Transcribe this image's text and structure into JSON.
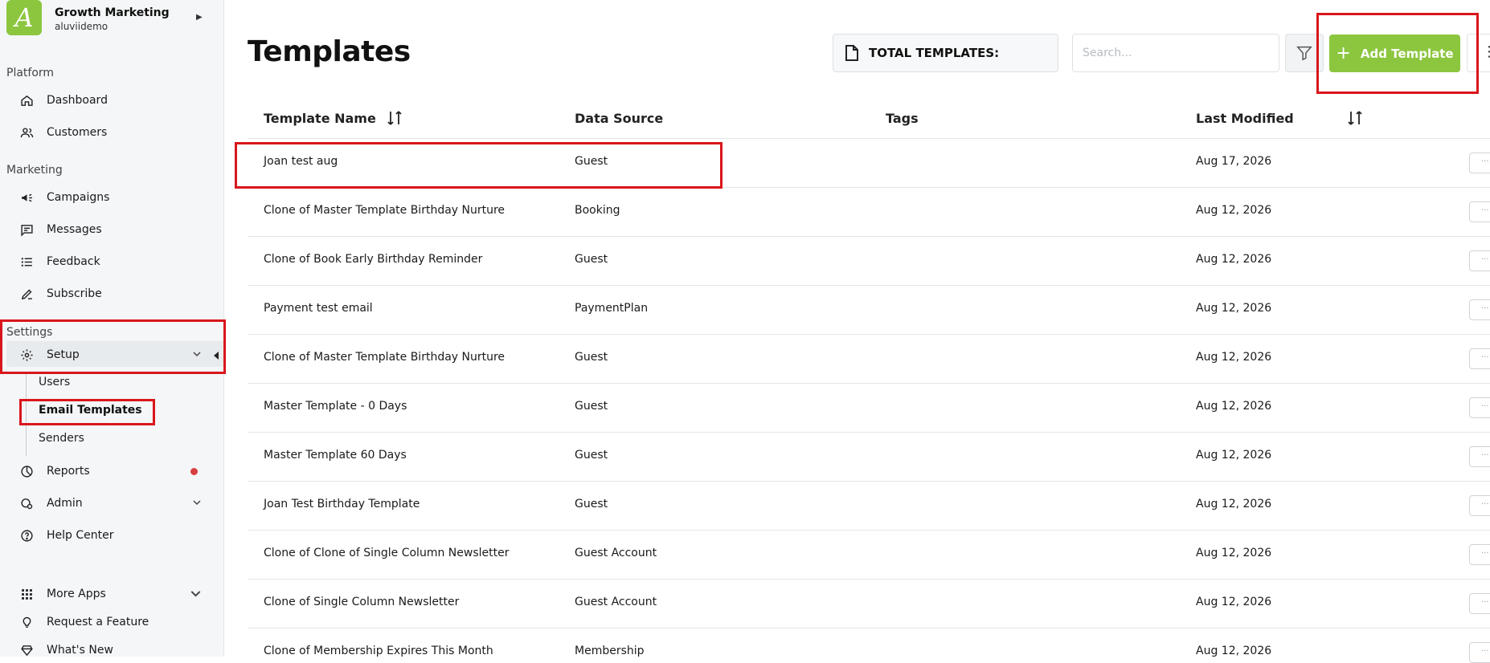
{
  "brand": {
    "logo_letter": "A",
    "org_name": "Growth Marketing",
    "org_sub": "aluviidemo"
  },
  "sidebar": {
    "sections": {
      "platform": "Platform",
      "marketing": "Marketing",
      "settings": "Settings"
    },
    "items": {
      "dashboard": "Dashboard",
      "customers": "Customers",
      "campaigns": "Campaigns",
      "messages": "Messages",
      "feedback": "Feedback",
      "subscribe": "Subscribe",
      "setup": "Setup",
      "reports": "Reports",
      "admin": "Admin",
      "help": "Help Center",
      "more_apps": "More Apps",
      "request_feature": "Request a Feature",
      "whats_new": "What's New"
    },
    "setup_children": {
      "users": "Users",
      "email_templates": "Email Templates",
      "senders": "Senders"
    }
  },
  "header": {
    "title": "Templates",
    "total_label": "TOTAL TEMPLATES:",
    "search_placeholder": "Search...",
    "add_label": "Add Template",
    "more_label": "⋮"
  },
  "table": {
    "columns": {
      "name": "Template Name",
      "source": "Data Source",
      "tags": "Tags",
      "modified": "Last Modified"
    },
    "rows": [
      {
        "name": "Joan test aug",
        "source": "Guest",
        "tags": "",
        "modified": "Aug 17, 2026"
      },
      {
        "name": "Clone of Master Template Birthday Nurture",
        "source": "Booking",
        "tags": "",
        "modified": "Aug 12, 2026"
      },
      {
        "name": "Clone of Book Early Birthday Reminder",
        "source": "Guest",
        "tags": "",
        "modified": "Aug 12, 2026"
      },
      {
        "name": "Payment test email",
        "source": "PaymentPlan",
        "tags": "",
        "modified": "Aug 12, 2026"
      },
      {
        "name": "Clone of Master Template Birthday Nurture",
        "source": "Guest",
        "tags": "",
        "modified": "Aug 12, 2026"
      },
      {
        "name": "Master Template - 0 Days",
        "source": "Guest",
        "tags": "",
        "modified": "Aug 12, 2026"
      },
      {
        "name": "Master Template 60 Days",
        "source": "Guest",
        "tags": "",
        "modified": "Aug 12, 2026"
      },
      {
        "name": "Joan Test Birthday Template",
        "source": "Guest",
        "tags": "",
        "modified": "Aug 12, 2026"
      },
      {
        "name": "Clone of Clone of Single Column Newsletter",
        "source": "Guest Account",
        "tags": "",
        "modified": "Aug 12, 2026"
      },
      {
        "name": "Clone of Single Column Newsletter",
        "source": "Guest Account",
        "tags": "",
        "modified": "Aug 12, 2026"
      },
      {
        "name": "Clone of Membership Expires This Month",
        "source": "Membership",
        "tags": "",
        "modified": "Aug 12, 2026"
      }
    ],
    "row_action_label": "···"
  },
  "colors": {
    "accent": "#8cc63f",
    "highlight": "#d9161c",
    "notification": "#d84040"
  },
  "icons": [
    "home-icon",
    "users-icon",
    "megaphone-icon",
    "message-icon",
    "feedback-icon",
    "pencil-icon",
    "gear-icon",
    "pie-icon",
    "admin-icon",
    "help-icon",
    "grid-icon",
    "lightbulb-icon",
    "gem-icon",
    "file-icon",
    "filter-icon",
    "sort-icon",
    "plus-icon"
  ]
}
